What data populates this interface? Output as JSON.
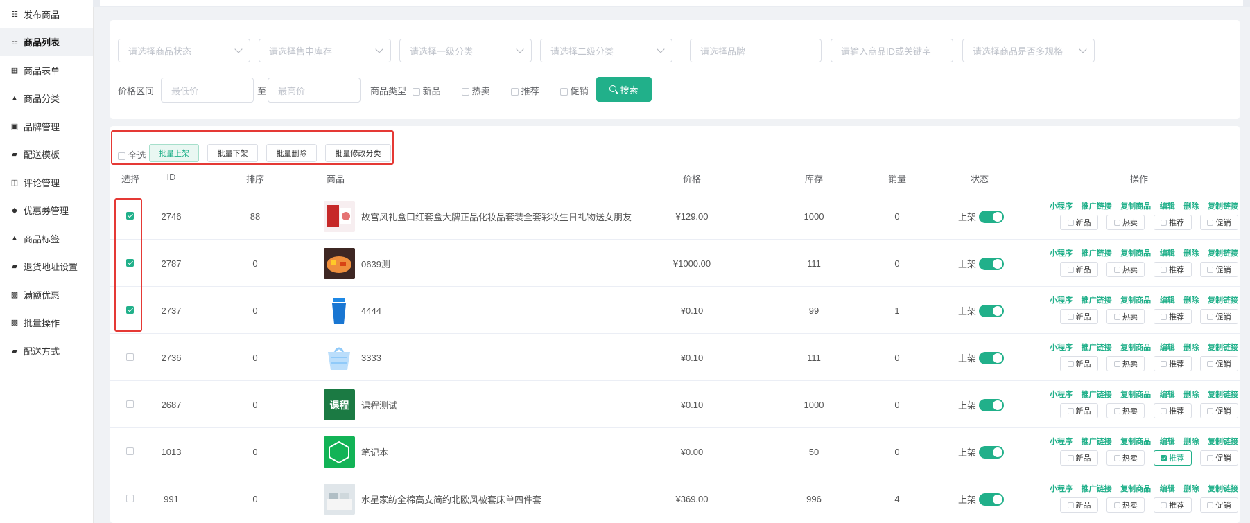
{
  "sidebar": {
    "items": [
      {
        "label": "发布商品",
        "icon": "boxes-icon"
      },
      {
        "label": "商品列表",
        "icon": "boxes-icon"
      },
      {
        "label": "商品表单",
        "icon": "document-icon"
      },
      {
        "label": "商品分类",
        "icon": "sitemap-icon"
      },
      {
        "label": "品牌管理",
        "icon": "briefcase-icon"
      },
      {
        "label": "配送模板",
        "icon": "truck-icon"
      },
      {
        "label": "评论管理",
        "icon": "book-icon"
      },
      {
        "label": "优惠券管理",
        "icon": "tag-icon"
      },
      {
        "label": "商品标签",
        "icon": "sitemap-icon"
      },
      {
        "label": "退货地址设置",
        "icon": "truck-icon"
      },
      {
        "label": "满额优惠",
        "icon": "gift-icon"
      },
      {
        "label": "批量操作",
        "icon": "gift-icon"
      },
      {
        "label": "配送方式",
        "icon": "truck-icon"
      }
    ]
  },
  "filters": {
    "status_placeholder": "请选择商品状态",
    "stock_placeholder": "请选择售中库存",
    "cat1_placeholder": "请选择一级分类",
    "cat2_placeholder": "请选择二级分类",
    "brand_placeholder": "请选择品牌",
    "keyword_placeholder": "请输入商品ID或关键字",
    "spec_placeholder": "请选择商品是否多规格",
    "price_label": "价格区间",
    "min_placeholder": "最低价",
    "to_label": "至",
    "max_placeholder": "最高价",
    "type_label": "商品类型",
    "types": [
      "新品",
      "热卖",
      "推荐",
      "促销"
    ],
    "search_label": "搜索"
  },
  "batch": {
    "select_all": "全选",
    "on_shelf": "批量上架",
    "off_shelf": "批量下架",
    "delete": "批量删除",
    "change_cat": "批量修改分类"
  },
  "table": {
    "headers": {
      "select": "选择",
      "id": "ID",
      "sort": "排序",
      "product": "商品",
      "price": "价格",
      "stock": "库存",
      "sales": "销量",
      "status": "状态",
      "ops": "操作"
    },
    "status_text": "上架",
    "op_links": [
      "小程序",
      "推广链接",
      "复制商品",
      "编辑",
      "删除",
      "复制链接"
    ],
    "tag_labels": [
      "新品",
      "热卖",
      "推荐",
      "促销"
    ],
    "rows": [
      {
        "checked": true,
        "id": "2746",
        "sort": "88",
        "name": "故宫风礼盒口红套盒大牌正品化妆品套装全套彩妆生日礼物送女朋友",
        "price": "¥129.00",
        "stock": "1000",
        "sales": "0",
        "thumb": "lipstick",
        "tags": [
          false,
          false,
          false,
          false
        ]
      },
      {
        "checked": true,
        "id": "2787",
        "sort": "0",
        "name": "0639测",
        "price": "¥1000.00",
        "stock": "111",
        "sales": "0",
        "thumb": "food",
        "tags": [
          false,
          false,
          false,
          false
        ]
      },
      {
        "checked": true,
        "id": "2737",
        "sort": "0",
        "name": "4444",
        "price": "¥0.10",
        "stock": "99",
        "sales": "1",
        "thumb": "cup",
        "tags": [
          false,
          false,
          false,
          false
        ]
      },
      {
        "checked": false,
        "id": "2736",
        "sort": "0",
        "name": "3333",
        "price": "¥0.10",
        "stock": "111",
        "sales": "0",
        "thumb": "basket",
        "tags": [
          false,
          false,
          false,
          false
        ]
      },
      {
        "checked": false,
        "id": "2687",
        "sort": "0",
        "name": "课程测试",
        "price": "¥0.10",
        "stock": "1000",
        "sales": "0",
        "thumb": "course",
        "thumb_text": "课程",
        "tags": [
          false,
          false,
          false,
          false
        ]
      },
      {
        "checked": false,
        "id": "1013",
        "sort": "0",
        "name": "笔记本",
        "price": "¥0.00",
        "stock": "50",
        "sales": "0",
        "thumb": "notebook",
        "tags": [
          false,
          false,
          true,
          false
        ]
      },
      {
        "checked": false,
        "id": "991",
        "sort": "0",
        "name": "水星家纺全棉高支简约北欧风被套床单四件套",
        "price": "¥369.00",
        "stock": "996",
        "sales": "4",
        "thumb": "bedding",
        "tags": [
          false,
          false,
          false,
          false
        ]
      }
    ]
  },
  "colors": {
    "accent": "#21b08a",
    "highlight": "#e53935"
  }
}
